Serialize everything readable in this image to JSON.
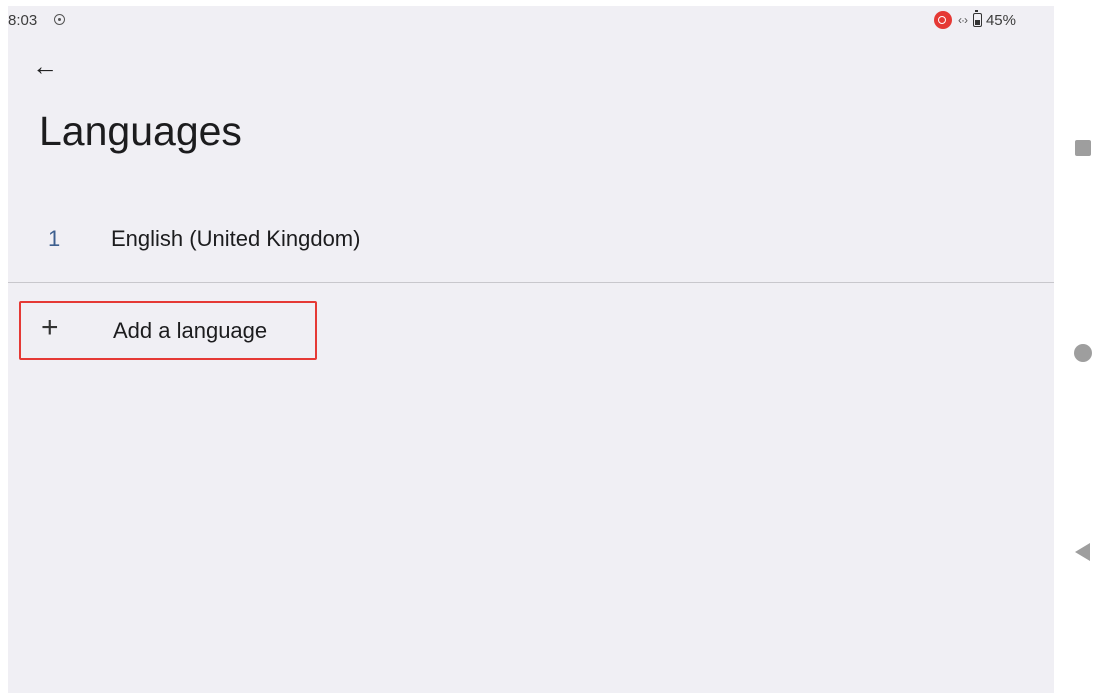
{
  "status_bar": {
    "time": "8:03",
    "battery_percent": "45%",
    "battery_level": 0.45,
    "icons": [
      "screen-record-icon",
      "cast-icon",
      "data-transfer-icon",
      "battery-icon"
    ]
  },
  "header": {
    "back_icon": "arrow-back-icon",
    "title": "Languages"
  },
  "languages": [
    {
      "number": "1",
      "name": "English (United Kingdom)"
    }
  ],
  "add_language": {
    "icon": "plus-icon",
    "label": "Add a language",
    "highlight_color": "#e53935"
  },
  "navigation_bar": {
    "icons": [
      "recents-icon",
      "home-icon",
      "back-icon"
    ]
  },
  "colors": {
    "background": "#f0eff4",
    "accent_number": "#3d5f8f",
    "highlight": "#e53935"
  }
}
